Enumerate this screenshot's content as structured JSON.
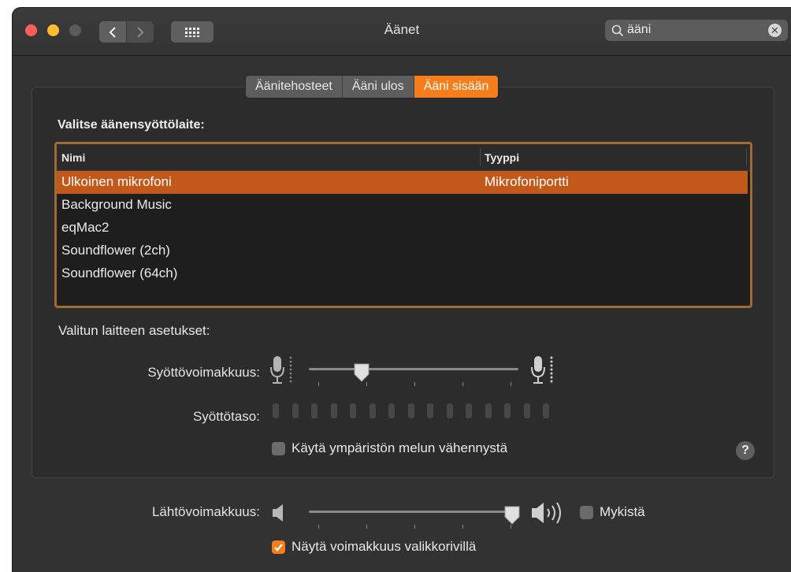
{
  "window": {
    "title": "Äänet",
    "search": {
      "value": "ääni",
      "clear_icon": "clear-icon"
    }
  },
  "tabs": [
    {
      "label": "Äänitehosteet",
      "active": false
    },
    {
      "label": "Ääni ulos",
      "active": false
    },
    {
      "label": "Ääni sisään",
      "active": true
    }
  ],
  "input": {
    "section_label": "Valitse äänensyöttölaite:",
    "table": {
      "columns": [
        "Nimi",
        "Tyyppi"
      ],
      "rows": [
        {
          "name": "Ulkoinen mikrofoni",
          "type": "Mikrofoniportti",
          "selected": true
        },
        {
          "name": "Background Music",
          "type": "",
          "selected": false
        },
        {
          "name": "eqMac2",
          "type": "",
          "selected": false
        },
        {
          "name": "Soundflower (2ch)",
          "type": "",
          "selected": false
        },
        {
          "name": "Soundflower (64ch)",
          "type": "",
          "selected": false
        }
      ]
    },
    "settings_label": "Valitun laitteen asetukset:",
    "input_volume_label": "Syöttövoimakkuus:",
    "input_volume_level": 0.25,
    "input_level_label": "Syöttötaso:",
    "input_level_segments": 15,
    "noise_reduction_label": "Käytä ympäristön melun vähennystä",
    "noise_reduction_checked": false,
    "help_label": "?"
  },
  "output": {
    "volume_label": "Lähtövoimakkuus:",
    "volume_level": 1.0,
    "mute_label": "Mykistä",
    "mute_checked": false,
    "show_in_menubar_label": "Näytä voimakkuus valikkorivillä",
    "show_in_menubar_checked": true
  },
  "colors": {
    "accent": "#f57d1c",
    "selection": "#c2591b",
    "focus_ring": "#a06a35"
  }
}
